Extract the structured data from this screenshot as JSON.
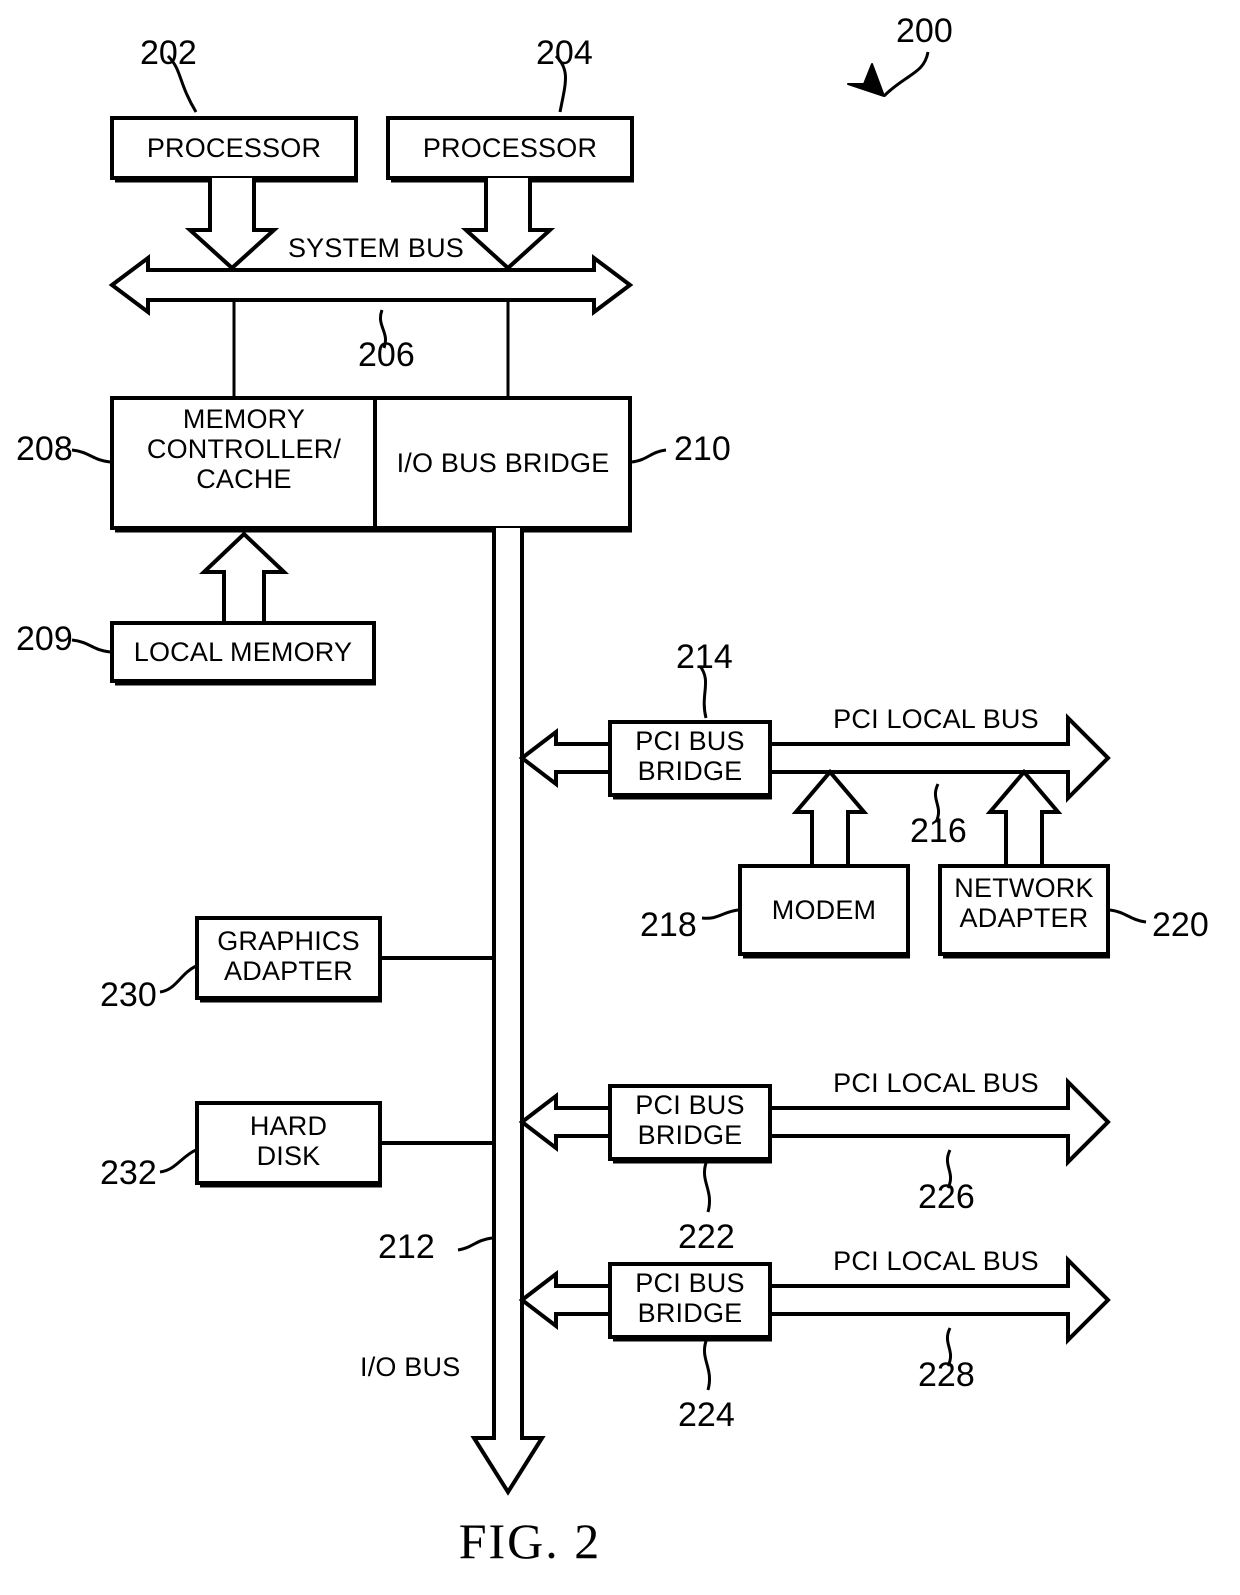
{
  "figure": {
    "caption": "FIG. 2",
    "top_reference": "200"
  },
  "blocks": [
    {
      "id": "processor-1",
      "label": "PROCESSOR",
      "ref": "202"
    },
    {
      "id": "processor-2",
      "label": "PROCESSOR",
      "ref": "204"
    },
    {
      "id": "memory-controller-cache",
      "label": "MEMORY\nCONTROLLER/\nCACHE",
      "ref": "208"
    },
    {
      "id": "io-bus-bridge",
      "label": "I/O BUS BRIDGE",
      "ref": "210"
    },
    {
      "id": "local-memory",
      "label": "LOCAL MEMORY",
      "ref": "209"
    },
    {
      "id": "pci-bus-bridge-1",
      "label": "PCI BUS\nBRIDGE",
      "ref": "214"
    },
    {
      "id": "modem",
      "label": "MODEM",
      "ref": "218"
    },
    {
      "id": "network-adapter",
      "label": "NETWORK\nADAPTER",
      "ref": "220"
    },
    {
      "id": "graphics-adapter",
      "label": "GRAPHICS\nADAPTER",
      "ref": "230"
    },
    {
      "id": "hard-disk",
      "label": "HARD\nDISK",
      "ref": "232"
    },
    {
      "id": "pci-bus-bridge-2",
      "label": "PCI BUS\nBRIDGE",
      "ref": "222"
    },
    {
      "id": "pci-bus-bridge-3",
      "label": "PCI BUS\nBRIDGE",
      "ref": "224"
    }
  ],
  "buses": [
    {
      "id": "system-bus",
      "label": "SYSTEM BUS",
      "ref": "206"
    },
    {
      "id": "io-bus",
      "label": "I/O BUS",
      "ref": "212"
    },
    {
      "id": "pci-local-bus-1",
      "label": "PCI LOCAL BUS",
      "ref": "216"
    },
    {
      "id": "pci-local-bus-2",
      "label": "PCI LOCAL BUS",
      "ref": "226"
    },
    {
      "id": "pci-local-bus-3",
      "label": "PCI LOCAL BUS",
      "ref": "228"
    }
  ],
  "colors": {
    "ink": "#000000",
    "paper": "#ffffff"
  }
}
